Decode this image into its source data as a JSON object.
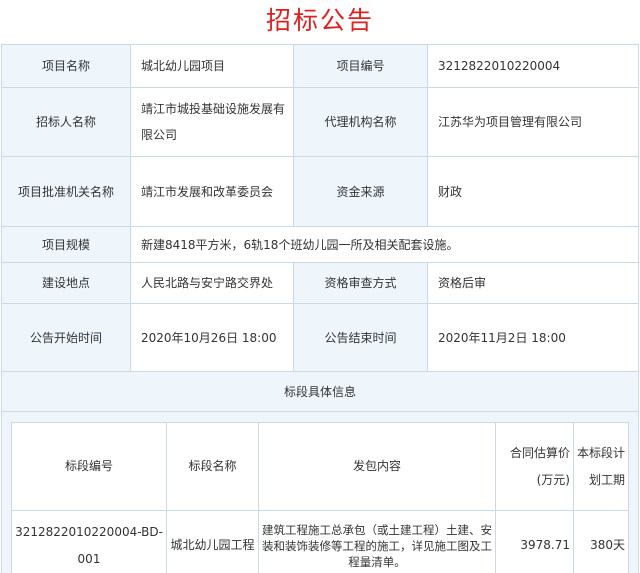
{
  "title": "招标公告",
  "project": {
    "name_label": "项目名称",
    "name_value": "城北幼儿园项目",
    "code_label": "项目编号",
    "code_value": "3212822010220004",
    "tenderer_label": "招标人名称",
    "tenderer_value": "靖江市城投基础设施发展有限公司",
    "agency_label": "代理机构名称",
    "agency_value": "江苏华为项目管理有限公司",
    "approval_label": "项目批准机关名称",
    "approval_value": "靖江市发展和改革委员会",
    "fund_label": "资金来源",
    "fund_value": "财政",
    "scale_label": "项目规模",
    "scale_value": "新建8418平方米，6轨18个班幼儿园一所及相关配套设施。",
    "location_label": "建设地点",
    "location_value": "人民北路与安宁路交界处",
    "review_label": "资格审查方式",
    "review_value": "资格后审",
    "start_label": "公告开始时间",
    "start_value": "2020年10月26日 18:00",
    "end_label": "公告结束时间",
    "end_value": "2020年11月2日 18:00"
  },
  "section": {
    "title": "标段具体信息",
    "headers": {
      "code": "标段编号",
      "name": "标段名称",
      "content": "发包内容",
      "price": "合同估算价(万元)",
      "period": "本标段计划工期"
    },
    "rows": [
      {
        "code": "3212822010220004-BD-001",
        "name": "城北幼儿园工程",
        "content": "建筑工程施工总承包（或土建工程）土建、安装和装饰装修等工程的施工，详见施工图及工程量清单。",
        "price": "3978.71",
        "period": "380天"
      }
    ]
  }
}
